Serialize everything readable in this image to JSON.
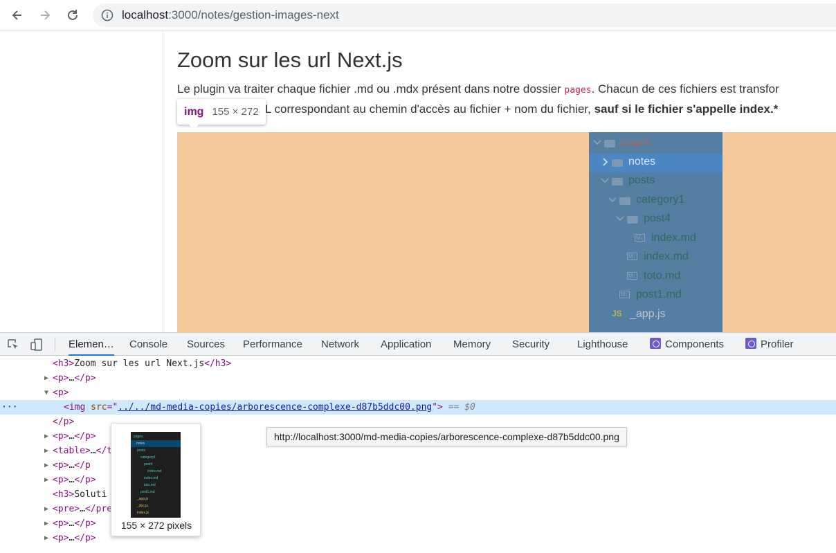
{
  "browser": {
    "url_host": "localhost",
    "url_path": ":3000/notes/gestion-images-next"
  },
  "page": {
    "title": "Zoom sur les url Next.js",
    "line1_before": "Le plugin va traiter chaque fichier .md ou .mdx présent dans notre dossier ",
    "line1_code": "pages",
    "line1_after": ". Chacun de ces fichiers est transfor",
    "line2_normal": "L correspondant au chemin d'accès au fichier + nom du fichier, ",
    "line2_bold": "sauf si le fichier s'appelle index.*"
  },
  "element_tooltip": {
    "tag": "img",
    "dimensions": "155 × 272"
  },
  "file_tree": [
    {
      "label": "pages",
      "kind": "folder",
      "open": true,
      "depth": 0
    },
    {
      "label": "notes",
      "kind": "folder",
      "open": false,
      "depth": 1,
      "selected": true
    },
    {
      "label": "posts",
      "kind": "folder",
      "open": true,
      "depth": 1
    },
    {
      "label": "category1",
      "kind": "folder",
      "open": true,
      "depth": 2
    },
    {
      "label": "post4",
      "kind": "folder",
      "open": true,
      "depth": 3
    },
    {
      "label": "index.md",
      "kind": "md",
      "depth": 4
    },
    {
      "label": "index.md",
      "kind": "md",
      "depth": 3
    },
    {
      "label": "toto.md",
      "kind": "md",
      "depth": 3
    },
    {
      "label": "post1.md",
      "kind": "md",
      "depth": 2
    },
    {
      "label": "_app.js",
      "kind": "js",
      "depth": 1
    }
  ],
  "devtools": {
    "tabs": [
      "Elemen…",
      "Console",
      "Sources",
      "Performance",
      "Network",
      "Application",
      "Memory",
      "Security",
      "Lighthouse",
      "Components",
      "Profiler"
    ],
    "active_tab": "Elemen…",
    "dom": {
      "h3_title": "Zoom sur les url Next.js",
      "collapsed": "…",
      "img_src": "../../md-media-copies/arborescence-complexe-d87b5ddc00.png",
      "eq_marker": "== $0",
      "h3_solution": "Soluti",
      "table_close_partial": "</t",
      "pre_close_partial": "</pre"
    },
    "thumbnail_caption": "155 × 272 pixels",
    "thumbnail_tree": [
      "pages",
      "notes",
      "posts",
      "category1",
      "post4",
      "index.md",
      "index.md",
      "toto.md",
      "post1.md",
      "_app.js",
      "_doc.js",
      "index.js"
    ],
    "url_tooltip": "http://localhost:3000/md-media-copies/arborescence-complexe-d87b5ddc00.png"
  },
  "colors": {
    "highlight": "#f6c99d",
    "tree_bg": "#557ea3",
    "selection": "#cfe8fc",
    "tab_accent": "#1a73e8"
  }
}
